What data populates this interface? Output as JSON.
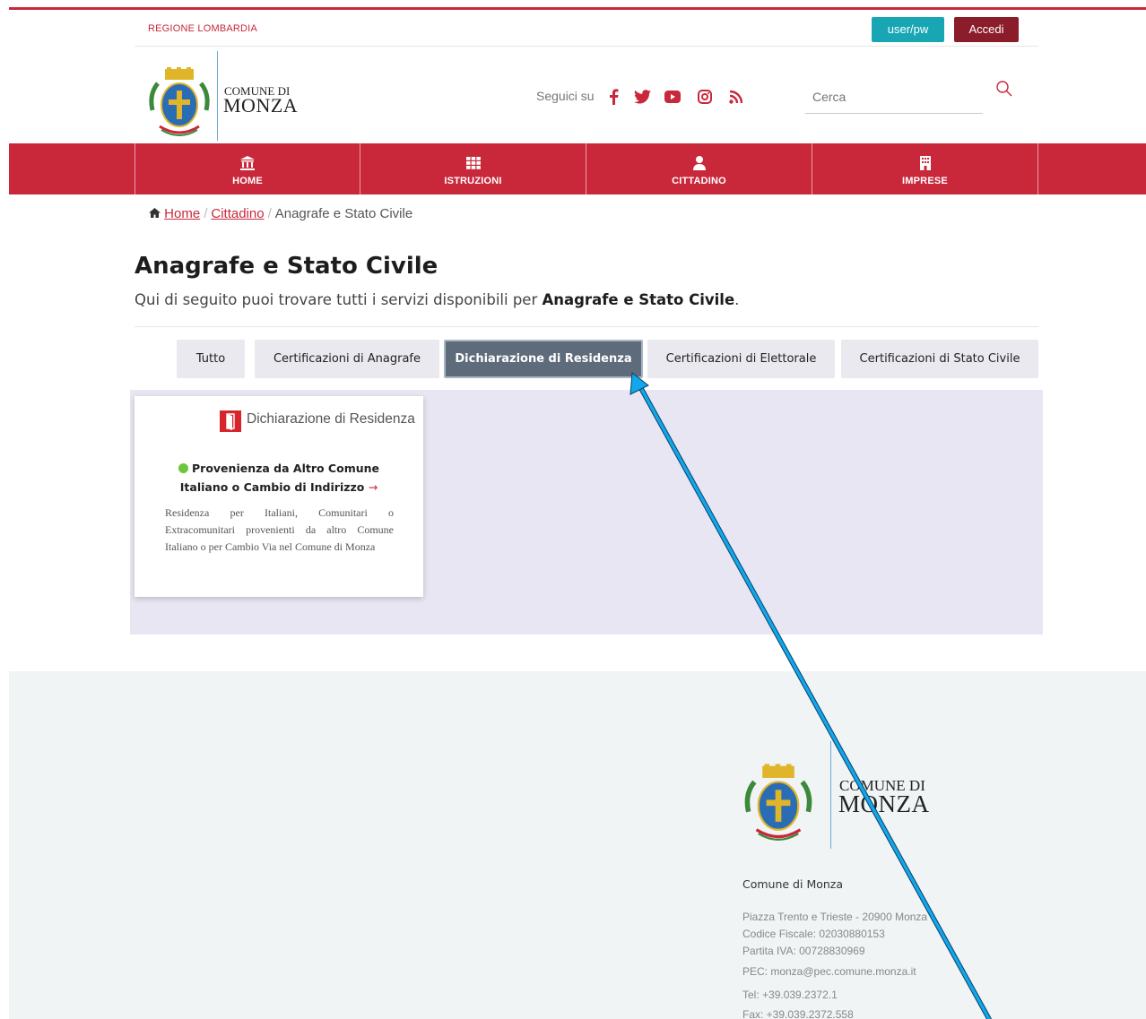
{
  "topbar": {
    "region": "REGIONE LOMBARDIA",
    "user_btn": "user/pw",
    "login_btn": "Accedi"
  },
  "header": {
    "logo_line1": "COMUNE DI",
    "logo_line2": "MONZA",
    "follow_label": "Seguici su",
    "social": [
      "facebook-icon",
      "twitter-icon",
      "youtube-icon",
      "instagram-icon",
      "rss-icon"
    ],
    "search_placeholder": "Cerca"
  },
  "nav": {
    "items": [
      {
        "label": "HOME",
        "icon": "bank-icon"
      },
      {
        "label": "ISTRUZIONI",
        "icon": "grid-icon"
      },
      {
        "label": "CITTADINO",
        "icon": "user-icon"
      },
      {
        "label": "IMPRESE",
        "icon": "building-icon"
      }
    ]
  },
  "breadcrumb": {
    "home": "Home",
    "level1": "Cittadino",
    "current": "Anagrafe e Stato Civile"
  },
  "page": {
    "title": "Anagrafe e Stato Civile",
    "subtitle_prefix": "Qui di seguito puoi trovare tutti i servizi disponibili per ",
    "subtitle_bold": "Anagrafe e Stato Civile",
    "subtitle_suffix": "."
  },
  "tabs": [
    {
      "label": "Tutto",
      "active": false
    },
    {
      "label": "Certificazioni di Anagrafe",
      "active": false
    },
    {
      "label": "Dichiarazione di Residenza",
      "active": true
    },
    {
      "label": "Certificazioni di Elettorale",
      "active": false
    },
    {
      "label": "Certificazioni di Stato Civile",
      "active": false
    }
  ],
  "card": {
    "category": "Dichiarazione di Residenza",
    "title_line1": "Provenienza da Altro Comune",
    "title_line2": "Italiano o Cambio di Indirizzo",
    "arrow": "→",
    "description": "Residenza per Italiani, Comunitari o Extracomunitari provenienti da altro Comune Italiano o per Cambio Via nel Comune di Monza"
  },
  "footer": {
    "logo_line1": "COMUNE DI",
    "logo_line2": "MONZA",
    "name": "Comune di Monza",
    "address": "Piazza Trento e Trieste - 20900 Monza",
    "codice_fiscale": "Codice Fiscale: 02030880153",
    "partita_iva": "Partita IVA: 00728830969",
    "pec": "PEC: monza@pec.comune.monza.it",
    "tel": "Tel: +39.039.2372.1",
    "fax": "Fax: +39.039.2372.558"
  },
  "colors": {
    "brand_red": "#c9283b",
    "login_dark_red": "#8b1c2a",
    "user_teal": "#19a6b4",
    "active_tab": "#5d6b7a",
    "panel_bg": "#e7e6f2",
    "annotation_arrow": "#11a7e8"
  }
}
